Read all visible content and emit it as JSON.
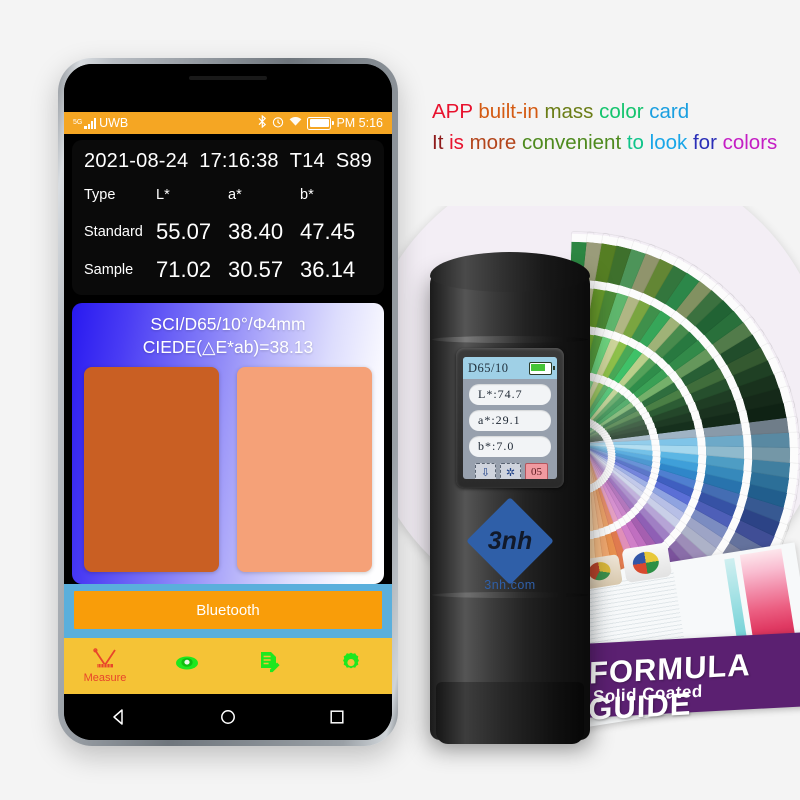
{
  "headline": {
    "line1_words": [
      {
        "text": "APP ",
        "color": "#e8112d"
      },
      {
        "text": "built-in ",
        "color": "#d45a12"
      },
      {
        "text": "mass ",
        "color": "#6b7d16"
      },
      {
        "text": "color ",
        "color": "#14c46e"
      },
      {
        "text": "card",
        "color": "#1a9fe0"
      }
    ],
    "line2_words": [
      {
        "text": "It ",
        "color": "#8e1b1b"
      },
      {
        "text": "is ",
        "color": "#e8112d"
      },
      {
        "text": "more ",
        "color": "#b3451b"
      },
      {
        "text": "convenient ",
        "color": "#4e8a1e"
      },
      {
        "text": "to ",
        "color": "#10c48a"
      },
      {
        "text": "look ",
        "color": "#19a6e8"
      },
      {
        "text": "for ",
        "color": "#2b2fb8"
      },
      {
        "text": "colors",
        "color": "#c41ec4"
      }
    ],
    "line1_plain": "APP built-in mass color card",
    "line2_plain": "It is more convenient to look for colors"
  },
  "phone": {
    "statusbar": {
      "network_gen": "5G",
      "carrier": "UWB",
      "bluetooth_icon": "bluetooth-icon",
      "alarm_icon": "alarm-icon",
      "wifi_icon": "wifi-icon",
      "battery_icon": "battery-icon",
      "time": "PM 5:16"
    },
    "measurement_card": {
      "date": "2021-08-24",
      "time": "17:16:38",
      "tag_t": "T14",
      "tag_s": "S89",
      "columns": [
        "Type",
        "L*",
        "a*",
        "b*"
      ],
      "rows": [
        {
          "label": "Standard",
          "L": "55.07",
          "a": "38.40",
          "b": "47.45"
        },
        {
          "label": "Sample",
          "L": "71.02",
          "a": "30.57",
          "b": "36.14"
        }
      ]
    },
    "color_panel": {
      "condition": "SCI/D65/10°/Φ4mm",
      "delta": "CIEDE(△E*ab)=38.13",
      "standard_swatch_color": "#c95f23",
      "sample_swatch_color": "#f5a178"
    },
    "bluetooth_button": {
      "label": "Bluetooth",
      "color": "#f99d09"
    },
    "tabs": [
      {
        "name": "measure",
        "label": "Measure",
        "icon": "measure-icon",
        "active": true
      },
      {
        "name": "view",
        "label": "",
        "icon": "eye-icon",
        "active": false
      },
      {
        "name": "records",
        "label": "",
        "icon": "document-icon",
        "active": false
      },
      {
        "name": "settings",
        "label": "",
        "icon": "gear-icon",
        "active": false
      }
    ],
    "navbar": [
      {
        "name": "back",
        "icon": "back-triangle-icon"
      },
      {
        "name": "home",
        "icon": "home-circle-icon"
      },
      {
        "name": "recents",
        "icon": "recents-square-icon"
      }
    ]
  },
  "device": {
    "screen": {
      "illuminant": "D65/10",
      "battery_icon": "battery-icon",
      "readings": [
        "L*:74.7",
        "a*:29.1",
        "b*:7.0"
      ],
      "icons": [
        "usb-icon",
        "bluetooth-icon"
      ],
      "badge": "05"
    },
    "brand": {
      "diamond_text": "3nh",
      "site": "3nh.com",
      "color": "#2f5fa8"
    }
  },
  "booklet": {
    "title": "FORMULA GUIDE",
    "subtitle": "Solid Coated",
    "banner_color": "#5b2071"
  },
  "fan_decks": {
    "left_colors": [
      "#3fbf5e",
      "#dcdfae",
      "#79b432",
      "#58a03f",
      "#6ed47f",
      "#cdd49a",
      "#8ec04a",
      "#49a857",
      "#3fc168",
      "#b9cf8a",
      "#54a25a",
      "#2f8d4a",
      "#3aa055",
      "#75b06a",
      "#2f6e3e",
      "#4a7f45",
      "#2c5c34",
      "#24472a",
      "#1e3a24",
      "#16301d"
    ],
    "right_colors": [
      "#9fb3c4",
      "#7fc4e8",
      "#a6d8ee",
      "#5bb6e4",
      "#3f9fd9",
      "#2f86c9",
      "#4f7fd0",
      "#3f5fc0",
      "#5b6fd6",
      "#8fa3e0",
      "#b7bfe6",
      "#c9cfe8",
      "#b6a4d6",
      "#a07fc4",
      "#8f5fb5",
      "#a55fb0",
      "#c06fc0",
      "#d07fc8",
      "#e08fb8",
      "#e07a4f",
      "#e8914f",
      "#f0a86f",
      "#f4bb84",
      "#f7cf9f"
    ]
  }
}
